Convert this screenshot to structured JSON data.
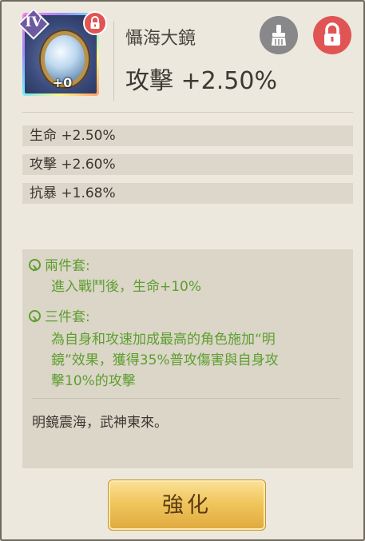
{
  "item": {
    "name": "懾海大鏡",
    "tier": "IV",
    "enhance_level": "+0",
    "main_stat": "攻擊 +2.50%"
  },
  "sub_stats": [
    "生命 +2.50%",
    "攻擊 +2.60%",
    "抗暴 +1.68%"
  ],
  "set_bonus": {
    "two_piece_title": "兩件套:",
    "two_piece_desc": "進入戰鬥後，生命+10%",
    "three_piece_title": "三件套:",
    "three_piece_desc": [
      "為自身和攻速加成最高的角色施加“明",
      "鏡”效果，獲得35%普攻傷害與自身攻",
      "擊10%的攻擊"
    ]
  },
  "flavor_text": "明鏡震海，武神東來。",
  "buttons": {
    "enhance": "強化"
  },
  "icons": {
    "tier_badge": "tier-badge-icon",
    "lock_small": "lock-icon",
    "lock_big": "lock-icon",
    "brush": "brush-icon",
    "set_marker": "chevron-circle-icon"
  },
  "colors": {
    "accent_green": "#5e9e2f",
    "lock_red": "#e05554",
    "button_gold": "#f0c65d"
  }
}
